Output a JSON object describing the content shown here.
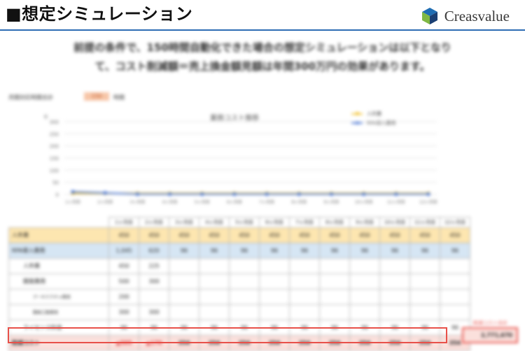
{
  "header": {
    "title": "■想定シミュレーション",
    "brand_name": "Creasvalue",
    "brand_colors": [
      "#1f6db3",
      "#7fb843",
      "#1a3f73"
    ]
  },
  "intro": {
    "line1": "前提の条件で、150時間自動化できた場合の想定シミュレーションは以下となり",
    "line2": "て、コスト削減額＝売上換金額見額は年間300万円の効果があります。"
  },
  "chart": {
    "hours_label": "月間対応時間合計",
    "hours_value": "150",
    "hours_unit": "時間",
    "title": "業務コスト推移",
    "legend": {
      "series1": "人件費",
      "series2": "RPA導入費用"
    }
  },
  "chart_data": {
    "type": "line",
    "title": "業務コスト推移",
    "categories": [
      "1ヶ月目",
      "2ヶ月目",
      "3ヶ月目",
      "4ヶ月目",
      "5ヶ月目",
      "6ヶ月目",
      "7ヶ月目",
      "8ヶ月目",
      "9ヶ月目",
      "10ヶ月目",
      "11ヶ月目",
      "12ヶ月目"
    ],
    "series": [
      {
        "name": "人件費",
        "color": "#f2c230",
        "values": [
          450,
          450,
          450,
          450,
          450,
          450,
          450,
          450,
          450,
          450,
          450,
          450
        ]
      },
      {
        "name": "RPA導入費用",
        "color": "#4a77d8",
        "values": [
          1045,
          620,
          96,
          96,
          96,
          96,
          96,
          96,
          96,
          96,
          96,
          96
        ]
      }
    ],
    "yticks": [
      "0",
      "50",
      "100",
      "150",
      "200",
      "250",
      "300"
    ],
    "ylabel": "千",
    "ylim": [
      0,
      3000
    ],
    "grid": true,
    "legend_position": "top-right"
  },
  "table": {
    "months": [
      "1ヶ月目",
      "2ヶ月目",
      "3ヶ月目",
      "4ヶ月目",
      "5ヶ月目",
      "6ヶ月目",
      "7ヶ月目",
      "8ヶ月目",
      "9ヶ月目",
      "10ヶ月目",
      "11ヶ月目",
      "12ヶ月目"
    ],
    "rows": [
      {
        "label": "人件費",
        "values": [
          "450",
          "450",
          "450",
          "450",
          "450",
          "450",
          "450",
          "450",
          "450",
          "450",
          "450",
          "450"
        ]
      },
      {
        "label": "RPA導入費用",
        "values": [
          "1,045",
          "620",
          "96",
          "96",
          "96",
          "96",
          "96",
          "96",
          "96",
          "96",
          "96",
          "96"
        ]
      },
      {
        "label": "人件費",
        "values": [
          "450",
          "225",
          "",
          "",
          "",
          "",
          "",
          "",
          "",
          "",
          "",
          ""
        ]
      },
      {
        "label": "開発費用",
        "values": [
          "500",
          "300",
          "",
          "",
          "",
          "",
          "",
          "",
          "",
          "",
          "",
          ""
        ]
      },
      {
        "label": "アーキテクチャ費用",
        "values": [
          "200",
          "",
          "",
          "",
          "",
          "",
          "",
          "",
          "",
          "",
          "",
          ""
        ]
      },
      {
        "label": "開発工数費用",
        "values": [
          "300",
          "300",
          "",
          "",
          "",
          "",
          "",
          "",
          "",
          "",
          "",
          ""
        ]
      },
      {
        "label": "ライセンス料金",
        "values": [
          "96",
          "96",
          "96",
          "96",
          "96",
          "96",
          "96",
          "96",
          "96",
          "96",
          "96",
          "96"
        ]
      },
      {
        "label": "削減コスト",
        "values": [
          "▲595",
          "▲170",
          "354",
          "354",
          "354",
          "354",
          "354",
          "354",
          "354",
          "354",
          "354",
          "354"
        ]
      }
    ],
    "sum_label": "削減コスト合計",
    "sum_value": "2,771,670"
  }
}
